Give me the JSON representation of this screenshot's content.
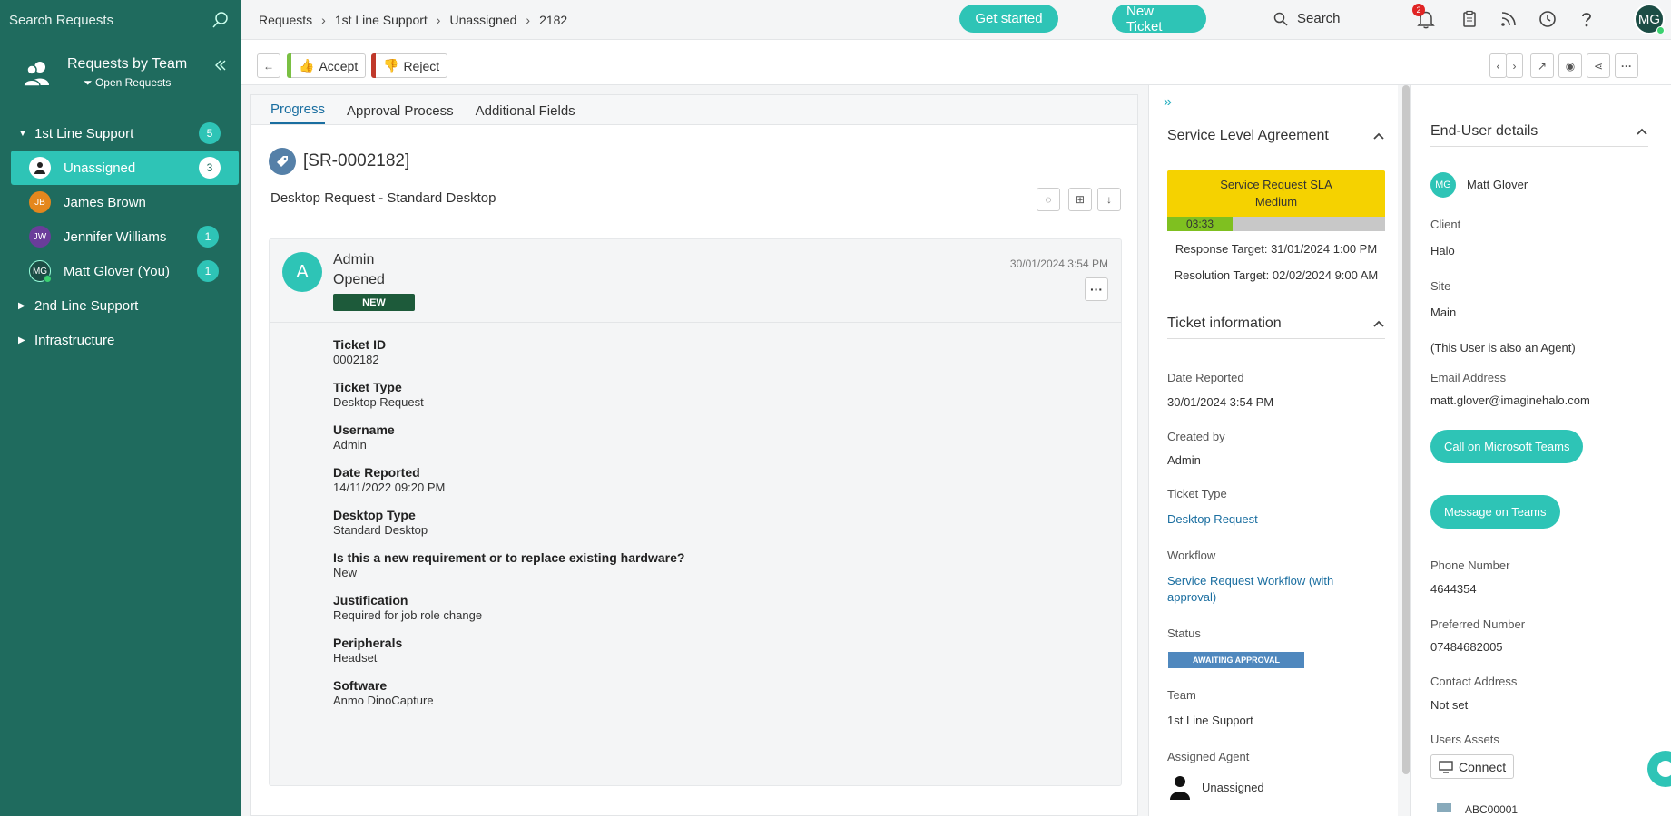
{
  "sidebar": {
    "search_placeholder": "Search Requests",
    "title": "Requests by Team",
    "filter": "Open Requests",
    "groups": [
      {
        "label": "1st Line Support",
        "count": "5"
      },
      {
        "label": "2nd Line Support"
      },
      {
        "label": "Infrastructure"
      }
    ],
    "agents": [
      {
        "label": "Unassigned",
        "count": "3",
        "initials": ""
      },
      {
        "label": "James Brown",
        "initials": "JB"
      },
      {
        "label": "Jennifer Williams",
        "count": "1",
        "initials": "JW"
      },
      {
        "label": "Matt Glover (You)",
        "count": "1",
        "initials": "MG"
      }
    ]
  },
  "topbar": {
    "breadcrumb": [
      "Requests",
      "1st Line Support",
      "Unassigned",
      "2182"
    ],
    "get_started": "Get started",
    "new_ticket": "New Ticket",
    "search": "Search",
    "notifications": "2",
    "user_initials": "MG"
  },
  "toolbar": {
    "accept": "Accept",
    "reject": "Reject"
  },
  "main": {
    "tabs": [
      "Progress",
      "Approval Process",
      "Additional Fields"
    ],
    "ticket_id": "[SR-0002182]",
    "summary": "Desktop Request - Standard Desktop",
    "action": {
      "avatar": "A",
      "who": "Admin",
      "what": "Opened",
      "badge": "NEW",
      "date": "30/01/2024 3:54 PM",
      "fields": [
        {
          "label": "Ticket ID",
          "value": "0002182"
        },
        {
          "label": "Ticket Type",
          "value": "Desktop Request"
        },
        {
          "label": "Username",
          "value": "Admin"
        },
        {
          "label": "Date Reported",
          "value": "14/11/2022 09:20 PM"
        },
        {
          "label": "Desktop Type",
          "value": "Standard Desktop"
        },
        {
          "label": "Is this a new requirement or to replace existing hardware?",
          "value": "New"
        },
        {
          "label": "Justification",
          "value": "Required for job role change"
        },
        {
          "label": "Peripherals",
          "value": "Headset"
        },
        {
          "label": "Software",
          "value": "Anmo DinoCapture"
        }
      ]
    }
  },
  "sla": {
    "title": "Service Level Agreement",
    "name": "Service Request SLA",
    "priority": "Medium",
    "timer": "03:33",
    "timer_progress": 0.3,
    "response": "Response Target: 31/01/2024 1:00 PM",
    "resolution": "Resolution Target: 02/02/2024 9:00 AM"
  },
  "ticket_info": {
    "title": "Ticket information",
    "date_reported_label": "Date Reported",
    "date_reported": "30/01/2024 3:54 PM",
    "created_by_label": "Created by",
    "created_by": "Admin",
    "ticket_type_label": "Ticket Type",
    "ticket_type": "Desktop Request",
    "workflow_label": "Workflow",
    "workflow": "Service Request Workflow (with approval)",
    "status_label": "Status",
    "status": "AWAITING APPROVAL",
    "team_label": "Team",
    "team": "1st Line Support",
    "agent_label": "Assigned Agent",
    "agent": "Unassigned"
  },
  "end_user": {
    "title": "End-User details",
    "initials": "MG",
    "name": "Matt Glover",
    "client_label": "Client",
    "client": "Halo",
    "site_label": "Site",
    "site": "Main",
    "agent_note": "(This User is also an Agent)",
    "email_label": "Email Address",
    "email": "matt.glover@imaginehalo.com",
    "call_teams": "Call on Microsoft Teams",
    "message_teams": "Message on Teams",
    "phone_label": "Phone Number",
    "phone": "4644354",
    "preferred_label": "Preferred Number",
    "preferred": "07484682005",
    "contact_label": "Contact Address",
    "contact": "Not set",
    "assets_label": "Users Assets",
    "connect": "Connect",
    "asset": "ABC00001"
  }
}
